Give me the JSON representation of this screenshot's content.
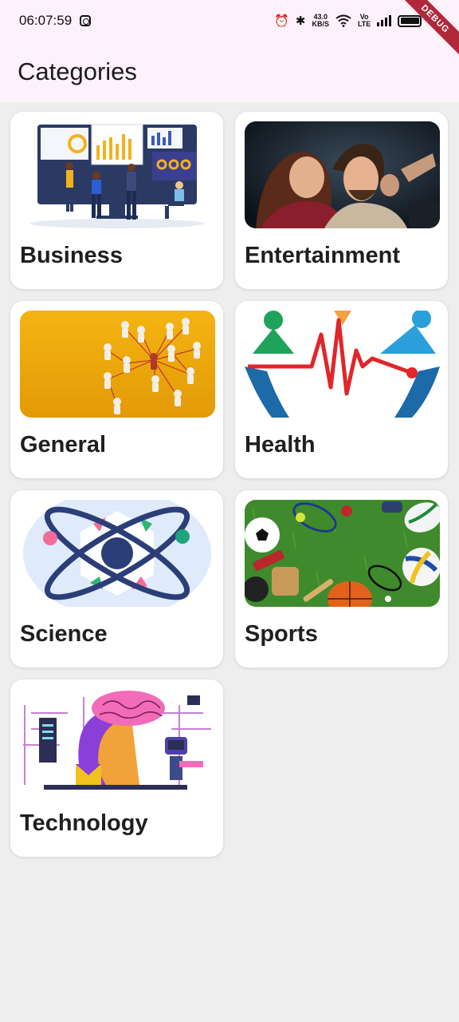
{
  "status_bar": {
    "time": "06:07:59",
    "net_speed_top": "43.0",
    "net_speed_bottom": "KB/S",
    "volte_top": "Vo",
    "volte_bottom": "LTE",
    "battery": "89"
  },
  "debug_banner": "DEBUG",
  "app_bar": {
    "title": "Categories"
  },
  "categories": [
    {
      "label": "Business"
    },
    {
      "label": "Entertainment"
    },
    {
      "label": "General"
    },
    {
      "label": "Health"
    },
    {
      "label": "Science"
    },
    {
      "label": "Sports"
    },
    {
      "label": "Technology"
    }
  ]
}
